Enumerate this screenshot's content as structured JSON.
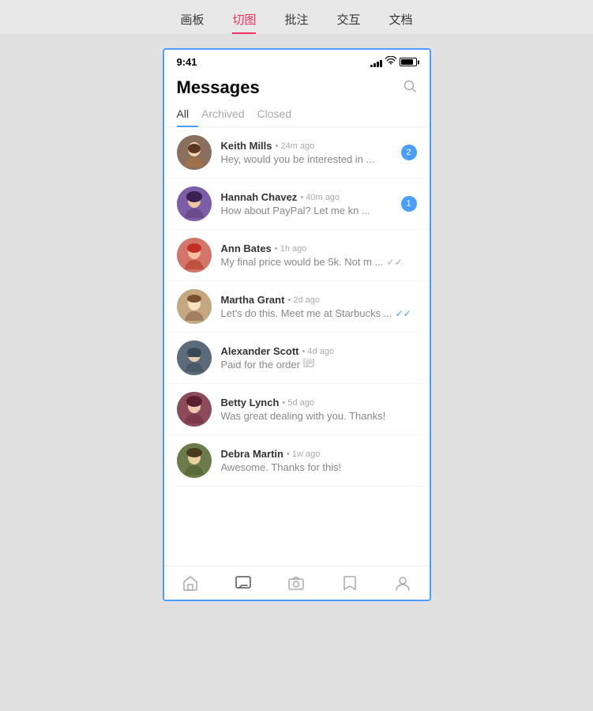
{
  "toolbar": {
    "items": [
      {
        "label": "画板",
        "active": false
      },
      {
        "label": "切图",
        "active": true
      },
      {
        "label": "批注",
        "active": false
      },
      {
        "label": "交互",
        "active": false
      },
      {
        "label": "文档",
        "active": false
      }
    ]
  },
  "phone": {
    "statusBar": {
      "time": "9:41",
      "signalBars": [
        3,
        5,
        7,
        9,
        11
      ],
      "wifi": "wifi",
      "battery": "battery"
    },
    "appHeader": {
      "title": "Messages",
      "searchIcon": "search"
    },
    "tabs": [
      {
        "label": "All",
        "active": true
      },
      {
        "label": "Archived",
        "active": false
      },
      {
        "label": "Closed",
        "active": false
      }
    ],
    "messages": [
      {
        "id": 1,
        "sender": "Keith Mills",
        "time": "24m ago",
        "preview": "Hey, would you be interested in ...",
        "badge": 2,
        "avatarColor": "av-1",
        "avatarEmoji": "👨"
      },
      {
        "id": 2,
        "sender": "Hannah Chavez",
        "time": "40m ago",
        "preview": "How about PayPal? Let me kn ...",
        "badge": 1,
        "avatarColor": "av-2",
        "avatarEmoji": "👩"
      },
      {
        "id": 3,
        "sender": "Ann Bates",
        "time": "1h ago",
        "preview": "My final price would be 5k. Not m ...",
        "badge": 0,
        "check": "double",
        "avatarColor": "av-3",
        "avatarEmoji": "👩"
      },
      {
        "id": 4,
        "sender": "Martha Grant",
        "time": "2d ago",
        "preview": "Let's do this. Meet me at Starbucks ...",
        "badge": 0,
        "check": "double-blue",
        "avatarColor": "av-4",
        "avatarEmoji": "👩"
      },
      {
        "id": 5,
        "sender": "Alexander Scott",
        "time": "4d ago",
        "preview": "Paid for the order",
        "badge": 0,
        "receipt": true,
        "avatarColor": "av-5",
        "avatarEmoji": "👨"
      },
      {
        "id": 6,
        "sender": "Betty Lynch",
        "time": "5d ago",
        "preview": "Was great dealing with you. Thanks!",
        "badge": 0,
        "avatarColor": "av-6",
        "avatarEmoji": "👩"
      },
      {
        "id": 7,
        "sender": "Debra Martin",
        "time": "1w ago",
        "preview": "Awesome. Thanks for this!",
        "badge": 0,
        "avatarColor": "av-7",
        "avatarEmoji": "👩"
      }
    ],
    "bottomNav": [
      {
        "icon": "🏠",
        "label": "home",
        "active": false
      },
      {
        "icon": "💬",
        "label": "messages",
        "active": true
      },
      {
        "icon": "📷",
        "label": "camera",
        "active": false
      },
      {
        "icon": "🔖",
        "label": "bookmark",
        "active": false
      },
      {
        "icon": "👤",
        "label": "profile",
        "active": false
      }
    ]
  }
}
